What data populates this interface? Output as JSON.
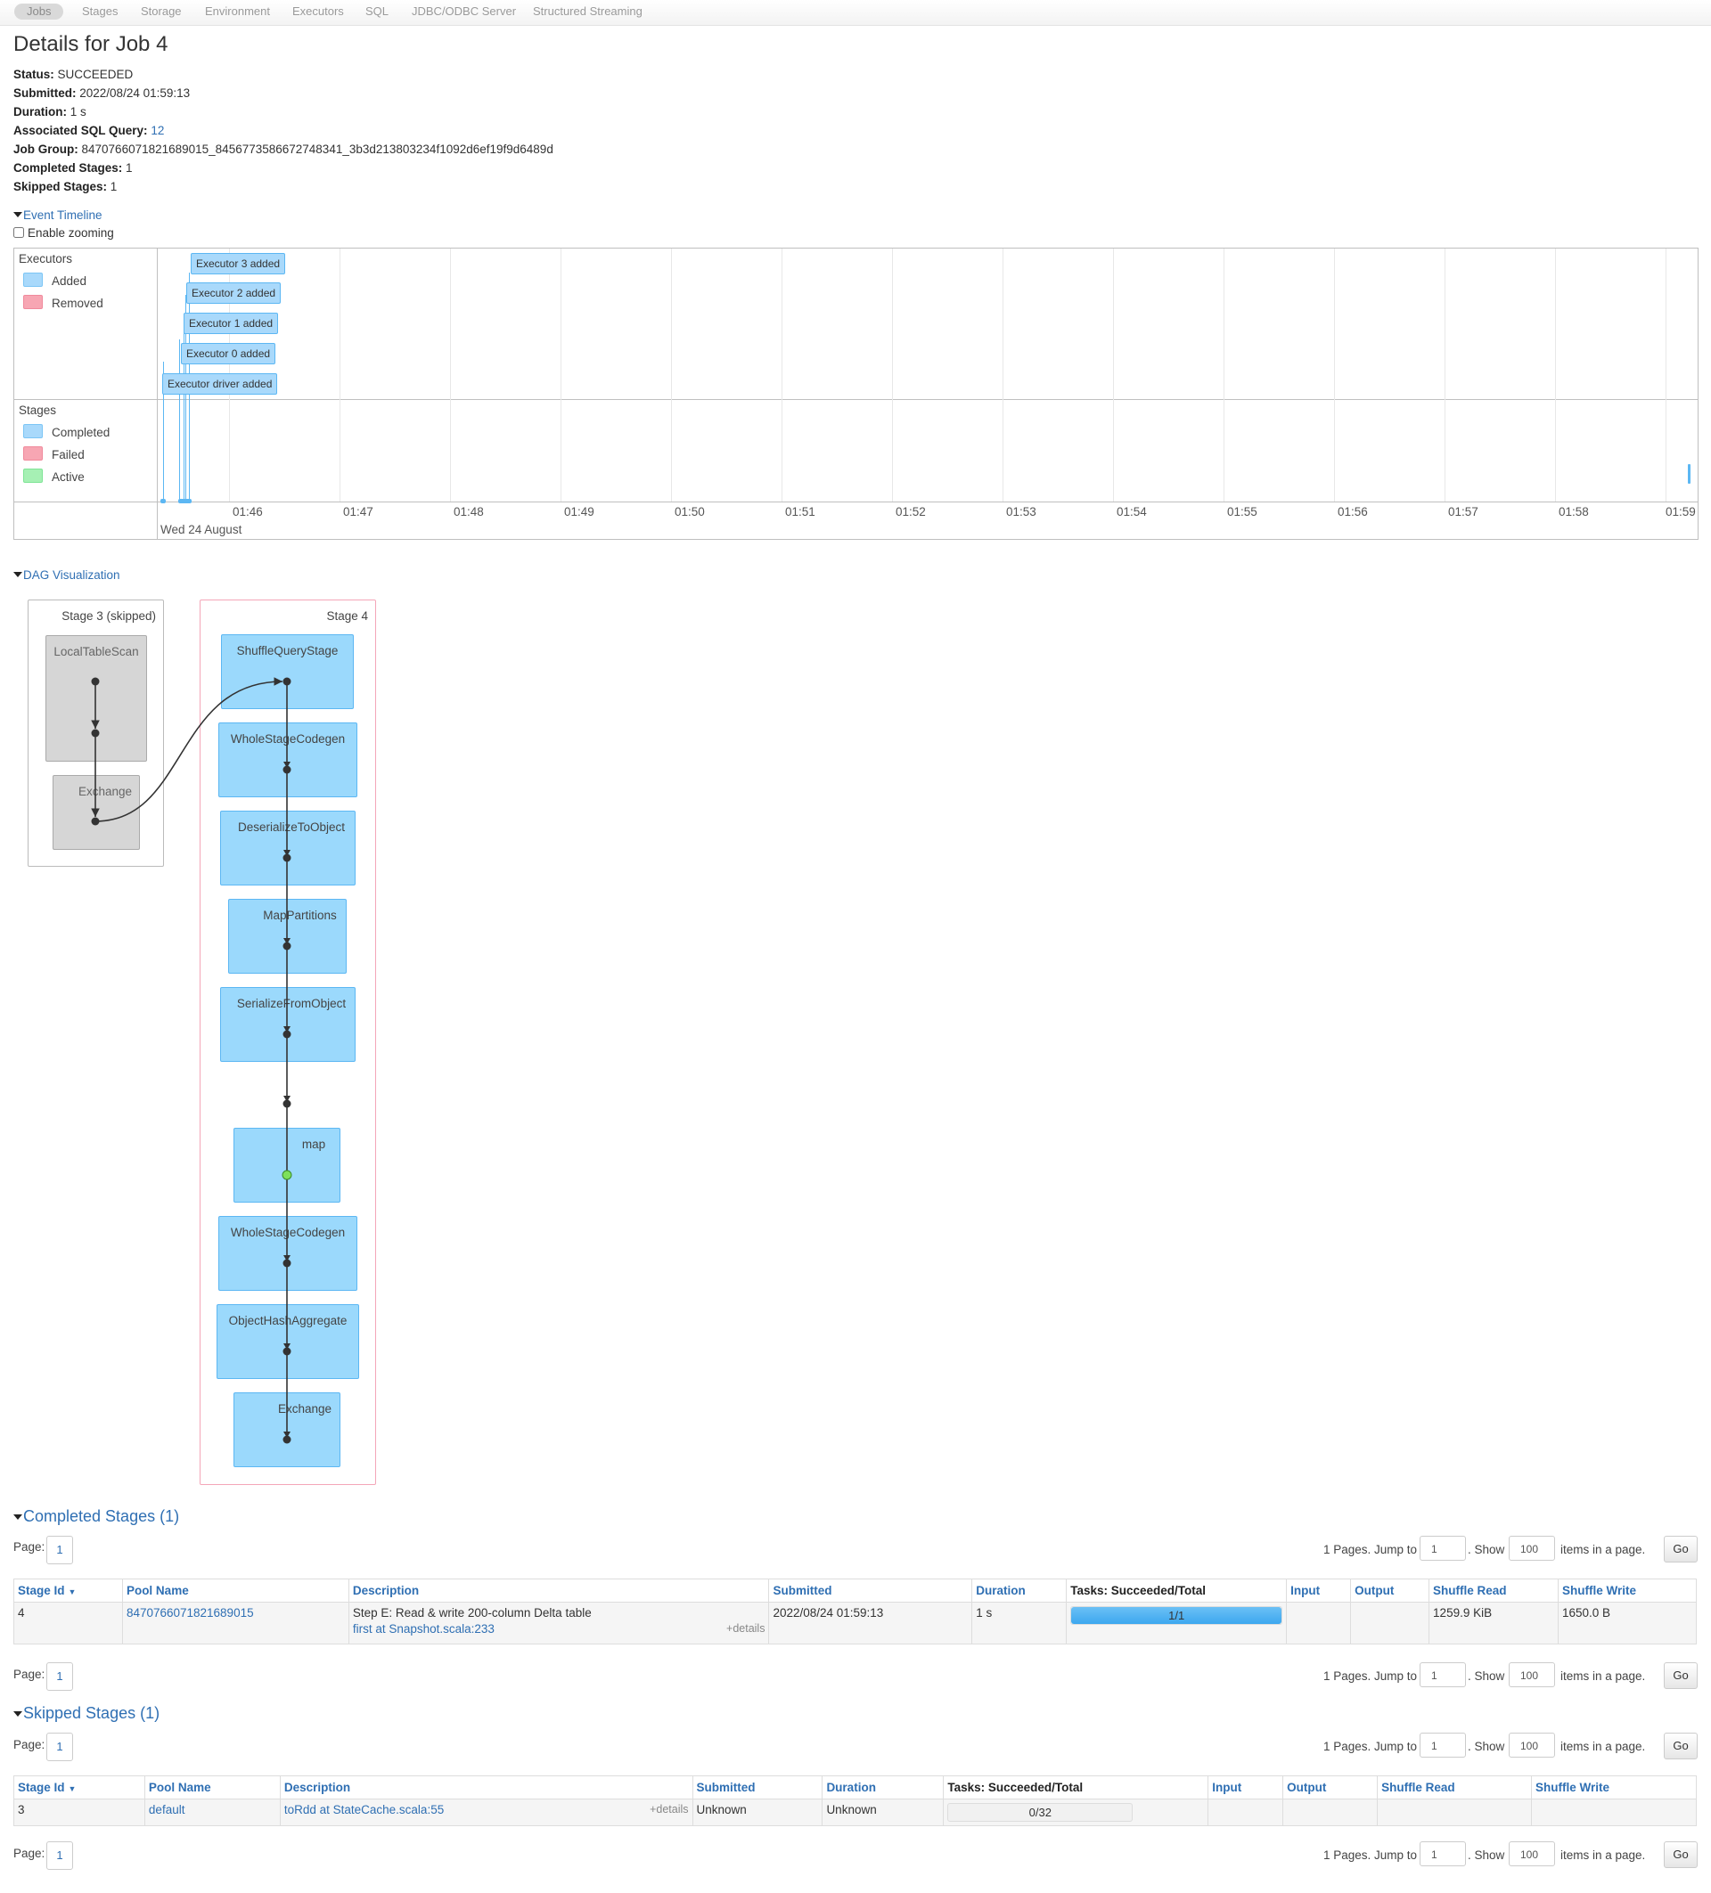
{
  "nav": {
    "tabs": [
      "Jobs",
      "Stages",
      "Storage",
      "Environment",
      "Executors",
      "SQL",
      "JDBC/ODBC Server",
      "Structured Streaming"
    ]
  },
  "page_title": "Details for Job 4",
  "summary": {
    "status_label": "Status:",
    "status": "SUCCEEDED",
    "submitted_label": "Submitted:",
    "submitted": "2022/08/24 01:59:13",
    "duration_label": "Duration:",
    "duration": "1 s",
    "sql_label": "Associated SQL Query:",
    "sql_query": "12",
    "job_group_label": "Job Group:",
    "job_group": "8470766071821689015_8456773586672748341_3b3d213803234f1092d6ef19f9d6489d",
    "completed_label": "Completed Stages:",
    "completed": "1",
    "skipped_label": "Skipped Stages:",
    "skipped": "1"
  },
  "event_timeline": {
    "toggle_label": "Event Timeline",
    "zoom_label": "Enable zooming",
    "executors_title": "Executors",
    "executor_legend": [
      "Added",
      "Removed"
    ],
    "stages_title": "Stages",
    "stage_legend": [
      "Completed",
      "Failed",
      "Active"
    ],
    "executor_events": [
      "Executor 3 added",
      "Executor 2 added",
      "Executor 1 added",
      "Executor 0 added",
      "Executor driver added"
    ],
    "ticks": [
      "01:46",
      "01:47",
      "01:48",
      "01:49",
      "01:50",
      "01:51",
      "01:52",
      "01:53",
      "01:54",
      "01:55",
      "01:56",
      "01:57",
      "01:58",
      "01:59"
    ],
    "date_label": "Wed 24 August",
    "colors": {
      "added": "#a9d9fb",
      "removed": "#f7a6b3",
      "completed": "#a9d9fb",
      "failed": "#f7a6b3",
      "active": "#a6f0b4"
    }
  },
  "dag": {
    "toggle_label": "DAG Visualization",
    "stage3_label": "Stage 3 (skipped)",
    "stage3_nodes": [
      "LocalTableScan",
      "Exchange"
    ],
    "stage4_label": "Stage 4",
    "stage4_nodes": [
      "ShuffleQueryStage",
      "WholeStageCodegen",
      "DeserializeToObject",
      "MapPartitions",
      "SerializeFromObject",
      "map",
      "WholeStageCodegen",
      "ObjectHashAggregate",
      "Exchange"
    ]
  },
  "completed_stages": {
    "title": "Completed Stages (1)",
    "page_label": "Page:",
    "page": "1",
    "pages_text": "1 Pages. Jump to",
    "jump_value": "1",
    "show_text": ". Show",
    "show_value": "100",
    "items_text": "items in a page.",
    "go_label": "Go",
    "headers": [
      "Stage Id",
      "Pool Name",
      "Description",
      "Submitted",
      "Duration",
      "Tasks: Succeeded/Total",
      "Input",
      "Output",
      "Shuffle Read",
      "Shuffle Write"
    ],
    "rows": [
      {
        "stage_id": "4",
        "pool": "8470766071821689015",
        "description": "Step E: Read & write 200-column Delta table",
        "description_link": "first at Snapshot.scala:233",
        "details": "+details",
        "submitted": "2022/08/24 01:59:13",
        "duration": "1 s",
        "tasks": "1/1",
        "tasks_fraction": 1.0,
        "input": "",
        "output": "",
        "shuffle_read": "1259.9 KiB",
        "shuffle_write": "1650.0 B"
      }
    ]
  },
  "skipped_stages": {
    "title": "Skipped Stages (1)",
    "page_label": "Page:",
    "page": "1",
    "pages_text": "1 Pages. Jump to",
    "jump_value": "1",
    "show_text": ". Show",
    "show_value": "100",
    "items_text": "items in a page.",
    "go_label": "Go",
    "headers": [
      "Stage Id",
      "Pool Name",
      "Description",
      "Submitted",
      "Duration",
      "Tasks: Succeeded/Total",
      "Input",
      "Output",
      "Shuffle Read",
      "Shuffle Write"
    ],
    "rows": [
      {
        "stage_id": "3",
        "pool": "default",
        "description_link": "toRdd at StateCache.scala:55",
        "details": "+details",
        "submitted": "Unknown",
        "duration": "Unknown",
        "tasks": "0/32",
        "tasks_fraction": 0.0,
        "input": "",
        "output": "",
        "shuffle_read": "",
        "shuffle_write": ""
      }
    ]
  }
}
